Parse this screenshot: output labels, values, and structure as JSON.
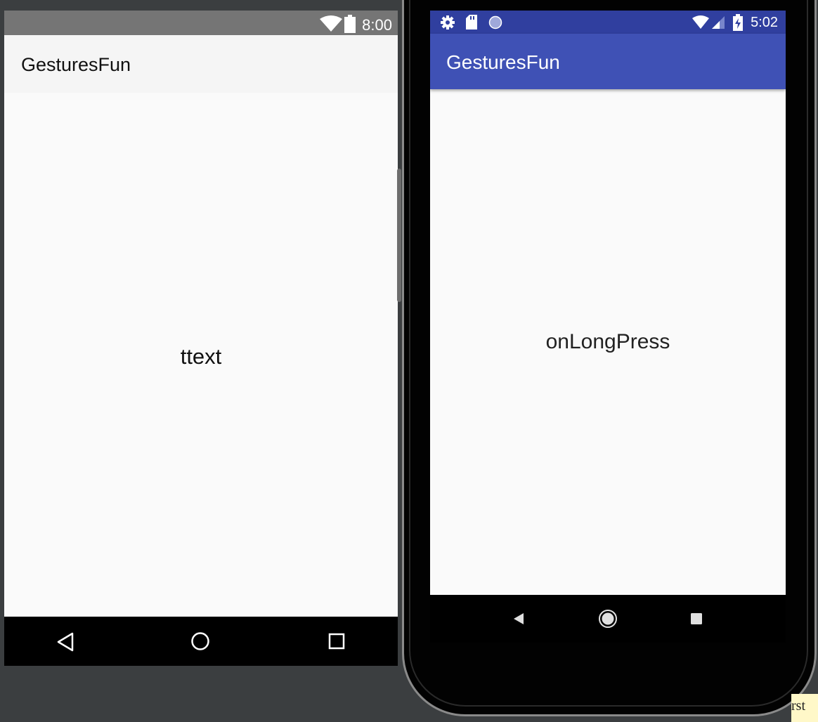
{
  "preview": {
    "status_time": "8:00",
    "app_title": "GesturesFun",
    "center_text": "ttext",
    "status_icons": [
      "wifi-icon",
      "battery-icon"
    ],
    "nav_icons": [
      "back-icon",
      "home-icon",
      "recents-icon"
    ]
  },
  "emulator": {
    "status_time": "5:02",
    "app_title": "GesturesFun",
    "center_text": "onLongPress",
    "status_icons_left": [
      "settings-icon",
      "sd-card-icon",
      "sync-icon"
    ],
    "status_icons_right": [
      "wifi-icon",
      "signal-icon",
      "battery-charging-icon"
    ],
    "nav_icons": [
      "back-icon",
      "home-icon",
      "recents-icon"
    ],
    "colors": {
      "status_bar": "#303f9f",
      "app_bar": "#3f51b5",
      "background": "#fafafa"
    }
  },
  "corner_note": {
    "text": "rst"
  }
}
